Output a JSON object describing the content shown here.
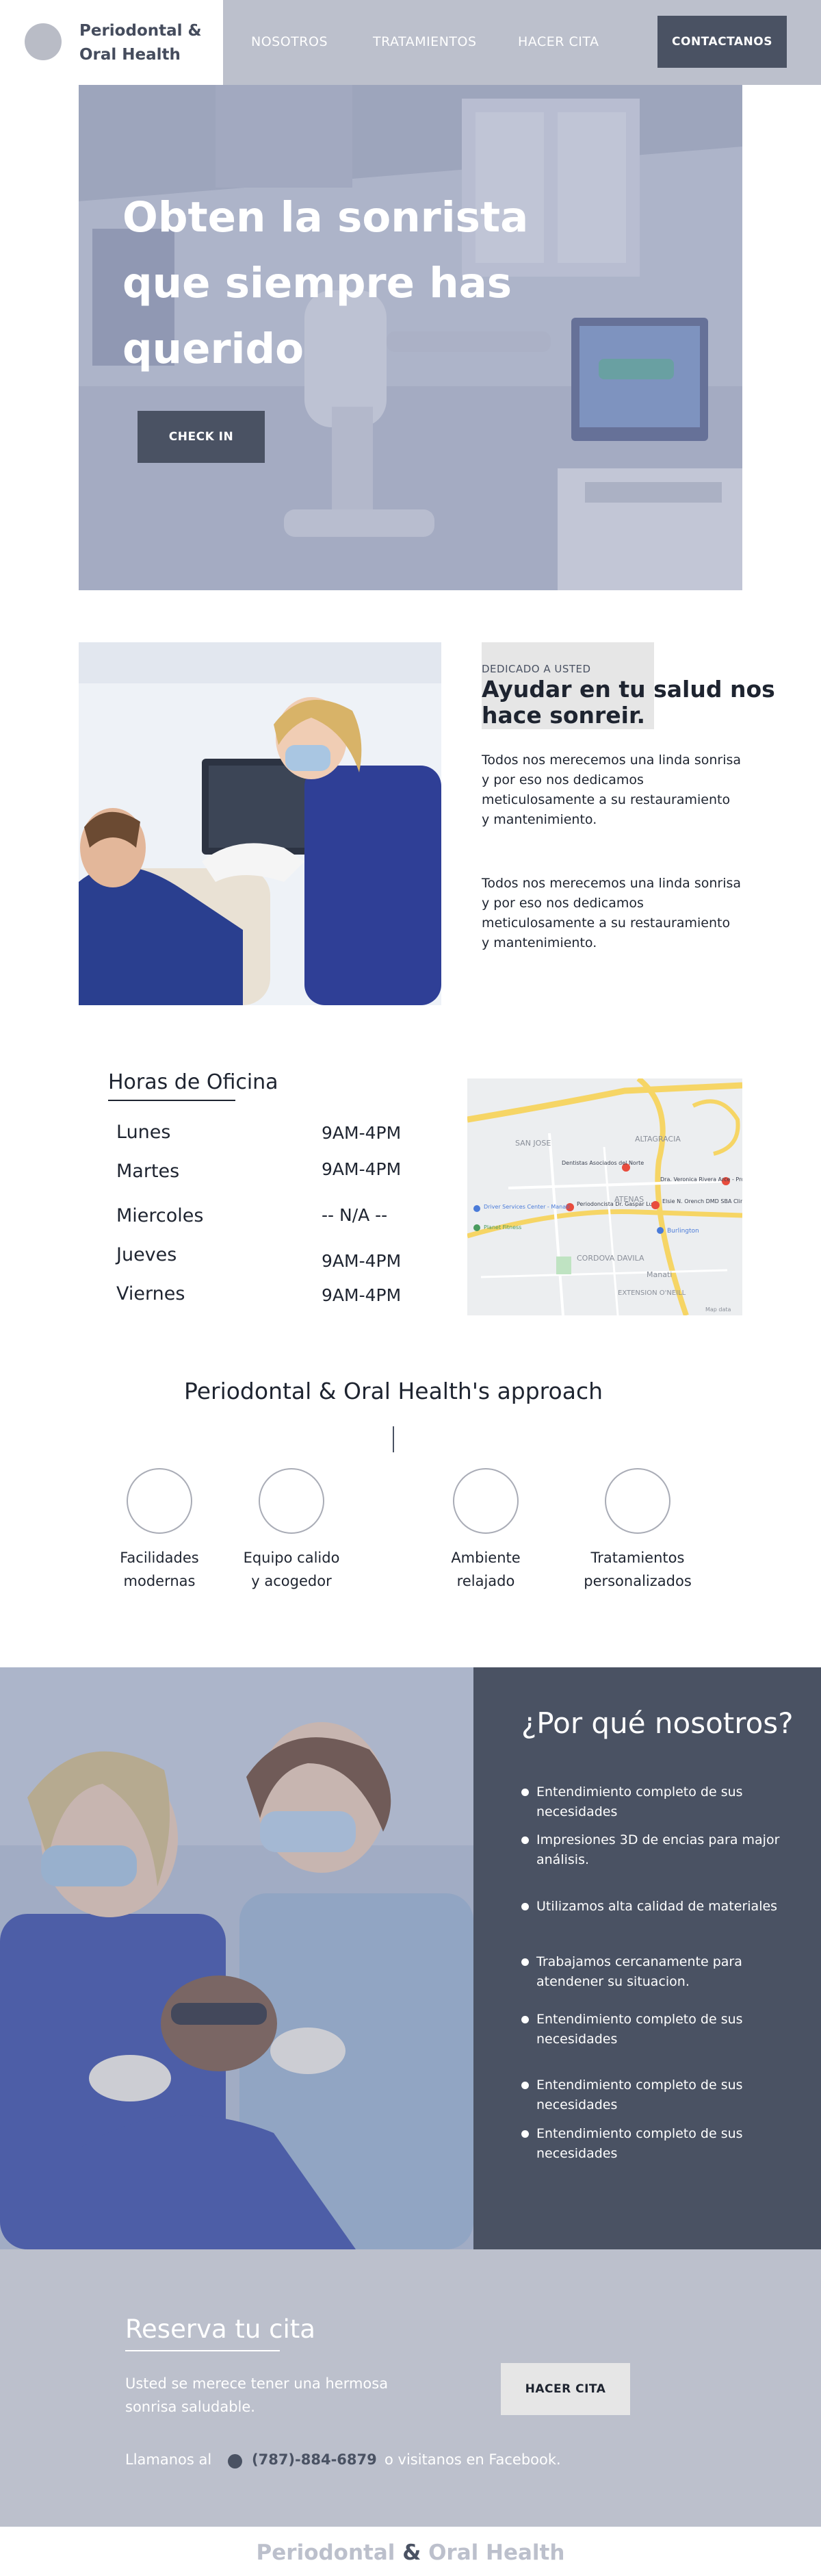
{
  "header": {
    "brand_name": "Periodontal & Oral Health",
    "nav": [
      "NOSOTROS",
      "TRATAMIENTOS",
      "HACER CITA"
    ],
    "cta": "CONTACTANOS"
  },
  "hero": {
    "title": "Obten la sonrista que siempre has querido",
    "button": "CHECK IN"
  },
  "dedicated": {
    "eyebrow": "DEDICADO A USTED",
    "title": "Ayudar en tu salud nos hace sonreir.",
    "paragraphs": [
      "Todos nos merecemos una linda sonrisa y por eso nos dedicamos meticulosamente a su restauramiento y mantenimiento.",
      "Todos nos merecemos una linda sonrisa y por eso nos dedicamos meticulosamente a su restauramiento y mantenimiento."
    ]
  },
  "hours": {
    "title": "Horas de Oficina",
    "rows": [
      {
        "day": "Lunes",
        "time": "9AM-4PM"
      },
      {
        "day": "Martes",
        "time": "9AM-4PM"
      },
      {
        "day": "Miercoles",
        "time": "-- N/A --"
      },
      {
        "day": "Jueves",
        "time": "9AM-4PM"
      },
      {
        "day": "Viernes",
        "time": "9AM-4PM"
      }
    ]
  },
  "map": {
    "labels": [
      "SAN JOSE",
      "ALTAGRACIA",
      "ATENAS",
      "CORDOVA DAVILA",
      "EXTENSION O'NEILL",
      "Manati"
    ],
    "places": [
      "Dentistas Asociados del Norte",
      "Dra. Veronica Rivera Arce - Prostodoncista",
      "Periodoncista Dr. Gaspar Lugo",
      "Elsie N. Orench DMD SBA Clinica",
      "Burlington",
      "Driver Services Center - Manati",
      "Planet Fitness"
    ],
    "attribution": "Map data"
  },
  "approach": {
    "title": "Periodontal & Oral Health's approach",
    "features": [
      {
        "line1": "Facilidades",
        "line2": "modernas"
      },
      {
        "line1": "Equipo calido",
        "line2": "y acogedor"
      },
      {
        "line1": "Ambiente",
        "line2": "relajado"
      },
      {
        "line1": "Tratamientos",
        "line2": "personalizados"
      }
    ]
  },
  "why": {
    "title": "¿Por qué nosotros?",
    "items": [
      "Entendimiento completo de sus necesidades",
      "Impresiones 3D de encias para major análisis.",
      "Utilizamos alta calidad de materiales",
      "Trabajamos cercanamente para atendener su situacion.",
      "Entendimiento completo de sus necesidades",
      "Entendimiento completo de sus necesidades",
      "Entendimiento completo de sus necesidades"
    ]
  },
  "booking": {
    "title": "Reserva tu cita",
    "text": "Usted se merece tener una hermosa sonrisa saludable.",
    "button": "HACER CITA",
    "call_prefix": "Llamanos al",
    "phone": "(787)-884-6879",
    "call_suffix": "o visitanos en Facebook."
  },
  "footer": {
    "brand_left": "Periodontal",
    "brand_amp": "&",
    "brand_right": "Oral Health"
  },
  "colors": {
    "primary": "#4a5263",
    "header_bg": "#bcc0cc",
    "light_box": "#e6e6e6"
  }
}
